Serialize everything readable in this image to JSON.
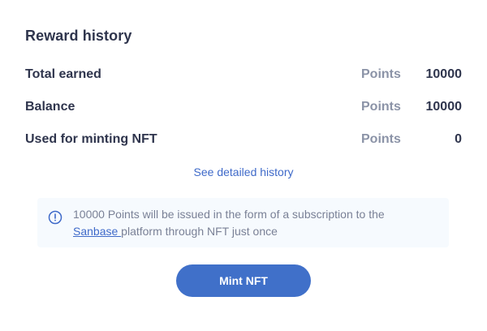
{
  "title": "Reward history",
  "rows": [
    {
      "label": "Total earned",
      "unit": "Points",
      "value": "10000"
    },
    {
      "label": "Balance",
      "unit": "Points",
      "value": "10000"
    },
    {
      "label": "Used for minting NFT",
      "unit": "Points",
      "value": "0"
    }
  ],
  "history_link": "See detailed history",
  "info": {
    "icon": "info-circle-icon",
    "text_before": "10000 Points will be issued in the form of a subscription to the",
    "link_text": "Sanbase ",
    "text_after": "platform through NFT just once"
  },
  "mint_button": "Mint NFT",
  "colors": {
    "accent": "#4070c9",
    "text": "#2f354d",
    "muted": "#8b93a7",
    "info_bg": "#f6fafe"
  }
}
